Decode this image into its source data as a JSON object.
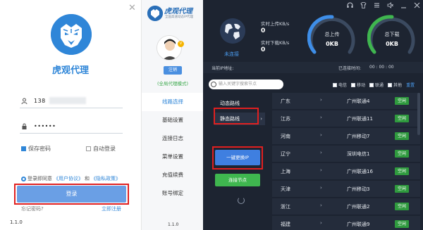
{
  "login": {
    "app_name": "虎观代理",
    "phone_value": "138",
    "password_value": "••••••",
    "remember_label": "保存密码",
    "autologin_label": "自动登录",
    "agree_prefix": "登录即同意",
    "user_agreement": "《用户协议》",
    "and": "和",
    "privacy": "《隐私政策》",
    "login_button": "登录",
    "forgot": "忘记密码?",
    "register": "立即注册",
    "version": "1.1.0"
  },
  "sidebar": {
    "brand_title": "虎观代理",
    "brand_sub": "全国高速动态IP代理",
    "vip_badge": "V",
    "logout": "注销",
    "mode": "(全局代理模式)",
    "items": [
      {
        "label": "线路选择",
        "active": true
      },
      {
        "label": "基础设置",
        "active": false
      },
      {
        "label": "连接日志",
        "active": false
      },
      {
        "label": "菜单设置",
        "active": false
      },
      {
        "label": "充值续费",
        "active": false
      },
      {
        "label": "账号绑定",
        "active": false
      }
    ],
    "version": "1.1.0"
  },
  "main": {
    "status": "未连接",
    "up_rate_label": "实时上传KB/s",
    "up_rate_value": "0",
    "down_rate_label": "实时下载KB/s",
    "down_rate_value": "0",
    "total_up_label": "总上传",
    "total_up_value": "0KB",
    "total_down_label": "总下载",
    "total_down_value": "0KB",
    "ip_label": "当前IP地址:",
    "elapsed_label": "已连接时间:",
    "elapsed_value": "00 : 00 : 00",
    "search_placeholder": "输入关键字搜索节点",
    "filters": [
      "电信",
      "移动",
      "联通",
      "其他"
    ],
    "reset": "重置",
    "routes": [
      {
        "label": "动态路线"
      },
      {
        "label": "静态路线"
      }
    ],
    "switch_ip": "一键更换IP",
    "connect": "连接节点",
    "rows": [
      {
        "province": "广东",
        "node": "广州联通4",
        "tag": "空闲"
      },
      {
        "province": "江苏",
        "node": "广州联通11",
        "tag": "空闲"
      },
      {
        "province": "河南",
        "node": "广州移动7",
        "tag": "空闲"
      },
      {
        "province": "辽宁",
        "node": "深圳电信1",
        "tag": "空闲"
      },
      {
        "province": "上海",
        "node": "广州联通16",
        "tag": "空闲"
      },
      {
        "province": "天津",
        "node": "广州移动3",
        "tag": "空闲"
      },
      {
        "province": "浙江",
        "node": "广州联通2",
        "tag": "空闲"
      },
      {
        "province": "福建",
        "node": "广州联通9",
        "tag": "空闲"
      }
    ]
  },
  "colors": {
    "brand_blue": "#2f86d8",
    "dark_bg": "#1d2431",
    "highlight_red": "#e02020",
    "idle_green": "#2f9a3e"
  }
}
